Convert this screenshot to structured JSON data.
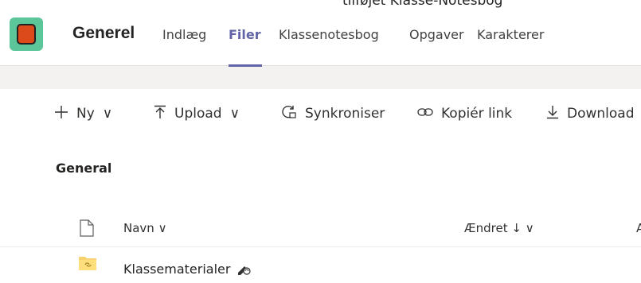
{
  "top_strip": {
    "partial_text": "tilføjet Klasse-Notesbog"
  },
  "header": {
    "channel_name": "Generel",
    "tabs": [
      {
        "label": "Indlæg",
        "active": false
      },
      {
        "label": "Filer",
        "active": true
      },
      {
        "label": "Klassenotesbog",
        "active": false
      },
      {
        "label": "Opgaver",
        "active": false
      },
      {
        "label": "Karakterer",
        "active": false
      }
    ],
    "accent_color": "#6264a7",
    "avatar_color": "#5cc59a"
  },
  "toolbar": {
    "new_label": "Ny",
    "upload_label": "Upload",
    "sync_label": "Synkroniser",
    "copy_link_label": "Kopiér link",
    "download_label": "Download",
    "chevron": "∨"
  },
  "content": {
    "breadcrumb": "General",
    "columns": {
      "name": "Navn",
      "changed": "Ændret",
      "sort_arrow": "↓",
      "chevron": "∨",
      "partial": "A"
    },
    "rows": [
      {
        "name": "Klassematerialer",
        "icon": "folder-icon",
        "status_icon": "sync-icon"
      }
    ]
  }
}
